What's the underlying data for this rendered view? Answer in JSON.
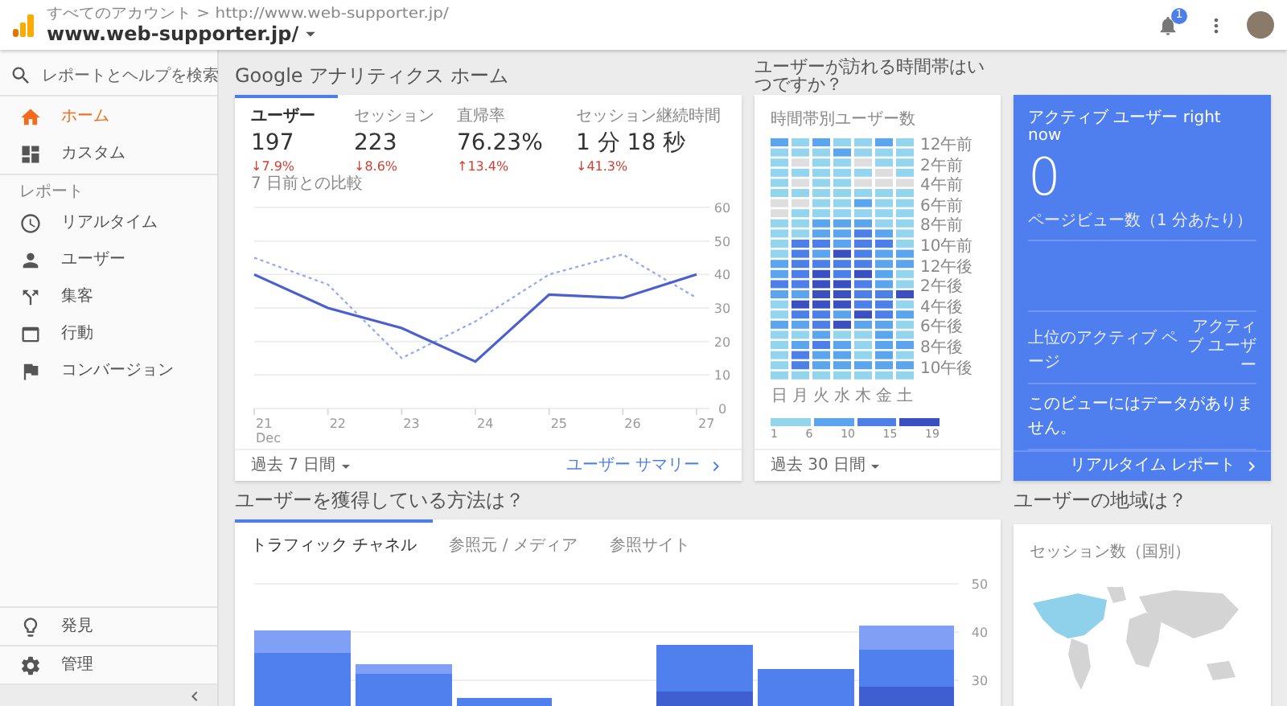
{
  "header": {
    "breadcrumb": "すべてのアカウント > http://www.web-supporter.jp/",
    "property": "www.web-supporter.jp/",
    "notification_count": "1"
  },
  "sidebar": {
    "search": "レポートとヘルプを検索",
    "top_items": [
      {
        "label": "ホーム",
        "selected": true
      },
      {
        "label": "カスタム",
        "selected": false
      }
    ],
    "section": "レポート",
    "report_items": [
      {
        "label": "リアルタイム",
        "selected": false
      },
      {
        "label": "ユーザー",
        "selected": false
      },
      {
        "label": "集客",
        "selected": false
      },
      {
        "label": "行動",
        "selected": false
      },
      {
        "label": "コンバージョン",
        "selected": false
      }
    ],
    "bottom_items": [
      {
        "label": "発見",
        "selected": false
      },
      {
        "label": "管理",
        "selected": false
      }
    ]
  },
  "home": {
    "title": "Google アナリティクス ホーム",
    "metrics": [
      {
        "label": "ユーザー",
        "value": "197",
        "change": "↓7.9%",
        "selected": true
      },
      {
        "label": "セッション",
        "value": "223",
        "change": "↓8.6%",
        "selected": false
      },
      {
        "label": "直帰率",
        "value": "76.23%",
        "change": "↑13.4%",
        "selected": false
      },
      {
        "label": "セッション継続時間",
        "value": "1 分 18 秒",
        "change": "↓41.3%",
        "selected": false
      }
    ],
    "comparison": "7 日前との比較",
    "chart_month": "Dec",
    "chart_data": {
      "type": "line",
      "categories": [
        "21",
        "22",
        "23",
        "24",
        "25",
        "26",
        "27"
      ],
      "series": [
        {
          "color": "#4a5fd0",
          "line_style": "solid",
          "values": [
            40,
            30,
            24,
            14,
            34,
            33,
            40
          ]
        },
        {
          "color": "#8fa9f2",
          "line_style": "dashed",
          "values": [
            45,
            37,
            15,
            26,
            40,
            46,
            33
          ]
        }
      ],
      "ylim": [
        0,
        60
      ],
      "yticks": [
        0,
        10,
        20,
        30,
        40,
        50,
        60
      ],
      "grid": true
    },
    "period": "過去 7 日間",
    "link": "ユーザー サマリー"
  },
  "hours": {
    "title": "ユーザーが訪れる時間帯はいつですか？",
    "subtitle": "時間帯別ユーザー数",
    "row_labels": [
      "12午前",
      "2午前",
      "4午前",
      "6午前",
      "8午前",
      "10午前",
      "12午後",
      "2午後",
      "4午後",
      "6午後",
      "8午後",
      "10午後"
    ],
    "days": [
      "日",
      "月",
      "火",
      "水",
      "木",
      "金",
      "土"
    ],
    "legend": [
      "1",
      "6",
      "10",
      "15",
      "19"
    ],
    "period": "過去 30 日間"
  },
  "realtime": {
    "title": "アクティブ ユーザー right now",
    "value": "0",
    "pageviews": "ページビュー数（1 分あたり）",
    "col_page": "上位のアクティブ ページ",
    "col_users": "アクティブ ユーザー",
    "empty": "このビューにはデータがありません。",
    "link": "リアルタイム レポート"
  },
  "acquisition": {
    "title": "ユーザーを獲得している方法は？",
    "tabs": [
      {
        "label": "トラフィック チャネル",
        "selected": true
      },
      {
        "label": "参照元 / メディア",
        "selected": false
      },
      {
        "label": "参照サイト",
        "selected": false
      }
    ],
    "axis_labels": [
      "50",
      "40",
      "30"
    ]
  },
  "geo": {
    "title": "ユーザーの地域は？",
    "subtitle": "セッション数（国別）"
  }
}
